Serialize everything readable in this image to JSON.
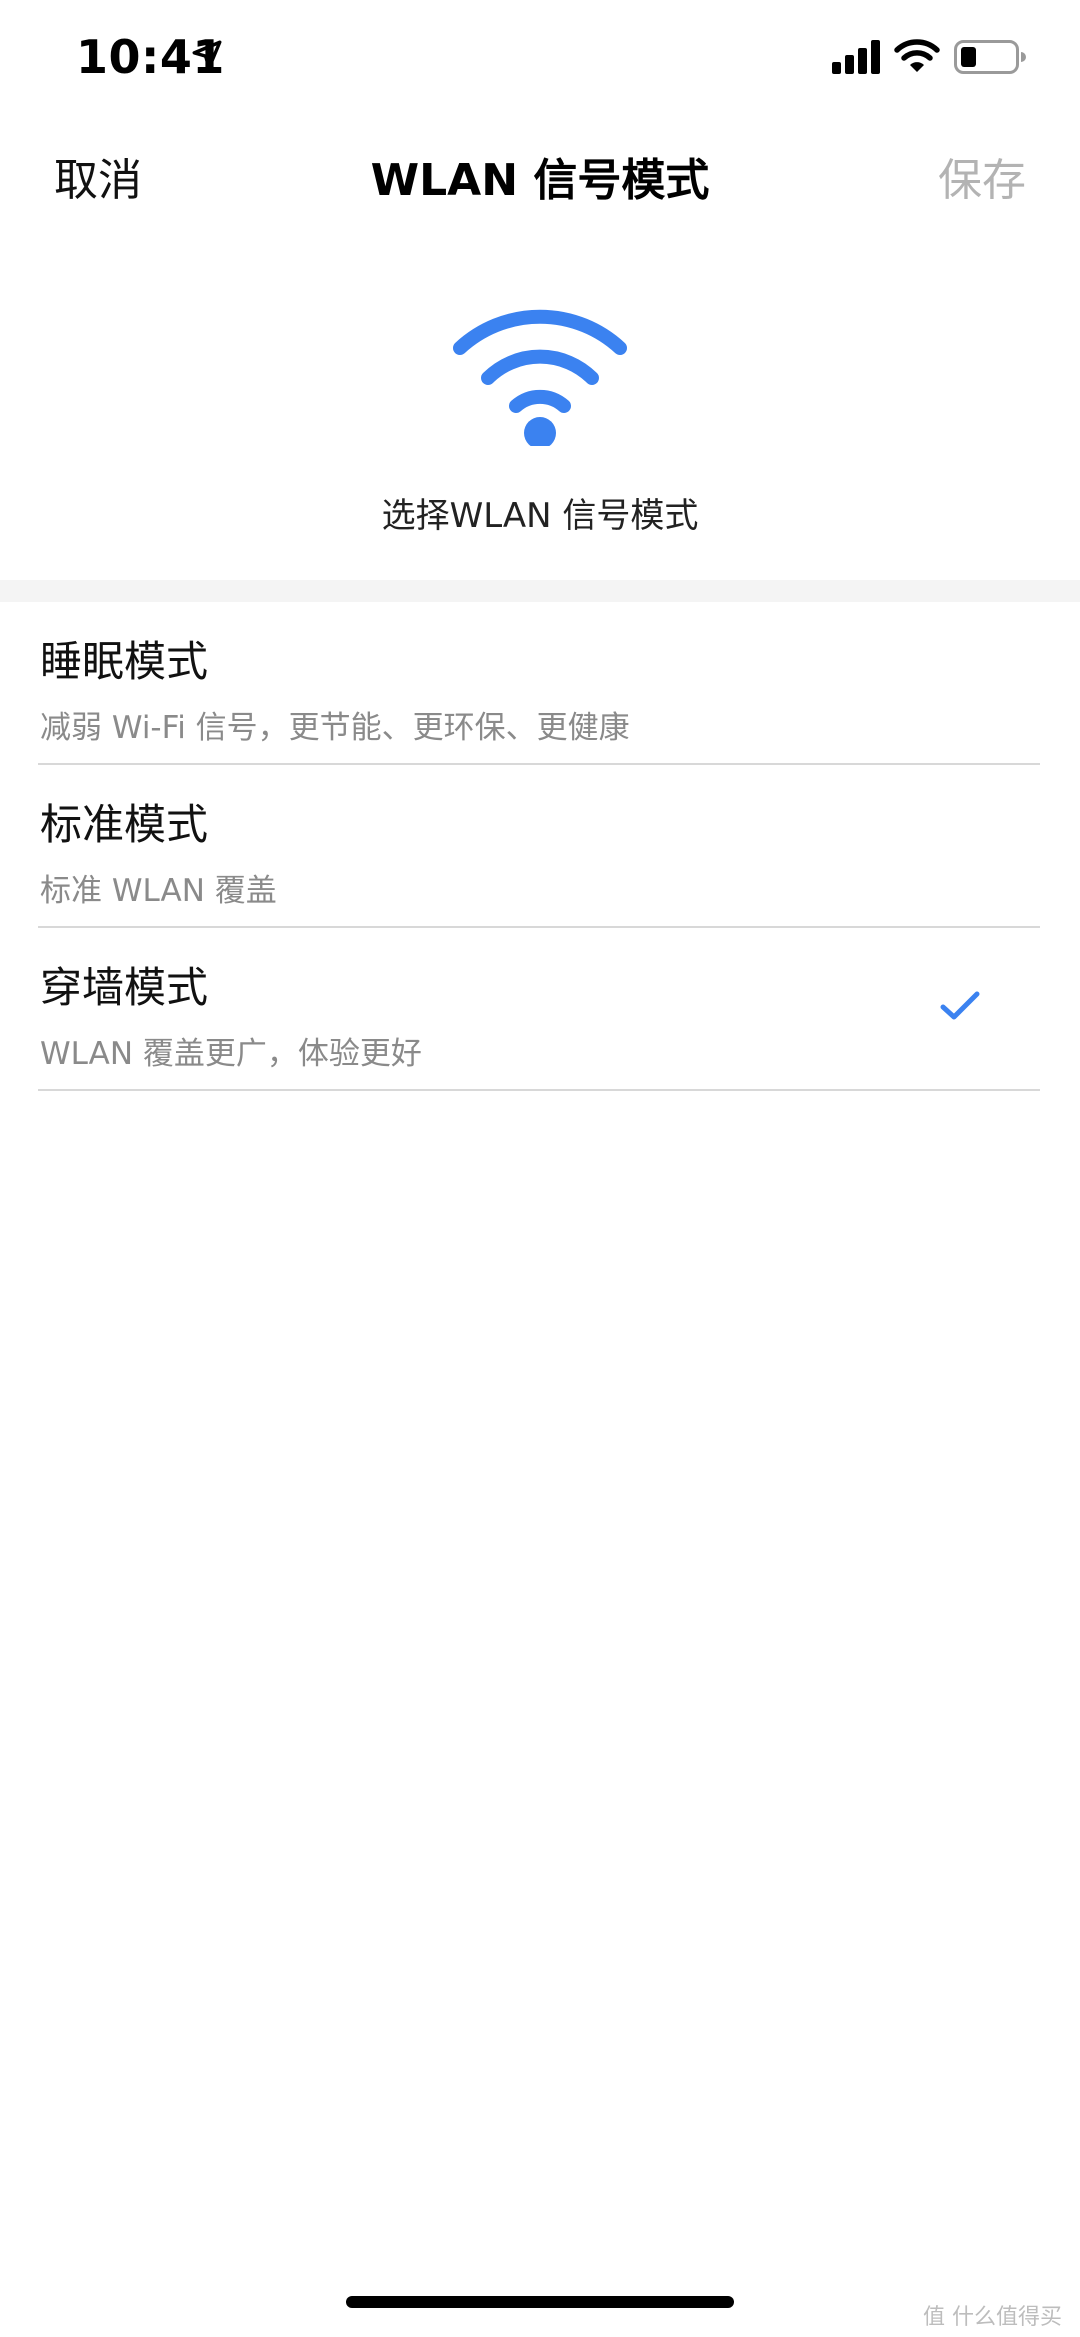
{
  "status_bar": {
    "time": "10:41",
    "icons": [
      "location-arrow-icon",
      "cellular-signal-icon",
      "wifi-icon",
      "battery-icon"
    ]
  },
  "nav": {
    "cancel_label": "取消",
    "title": "WLAN 信号模式",
    "save_label": "保存"
  },
  "hero": {
    "icon": "wifi-icon",
    "subtitle": "选择WLAN 信号模式"
  },
  "modes": [
    {
      "title": "睡眠模式",
      "description": "减弱 Wi-Fi 信号，更节能、更环保、更健康",
      "selected": false
    },
    {
      "title": "标准模式",
      "description": "标准 WLAN 覆盖",
      "selected": false
    },
    {
      "title": "穿墙模式",
      "description": "WLAN 覆盖更广，体验更好",
      "selected": true
    }
  ],
  "watermark": "值 什么值得买",
  "colors": {
    "accent": "#3b82f0",
    "save_disabled": "#b3b3b3",
    "description": "#8a8a8a",
    "divider": "#d8d8d8"
  }
}
